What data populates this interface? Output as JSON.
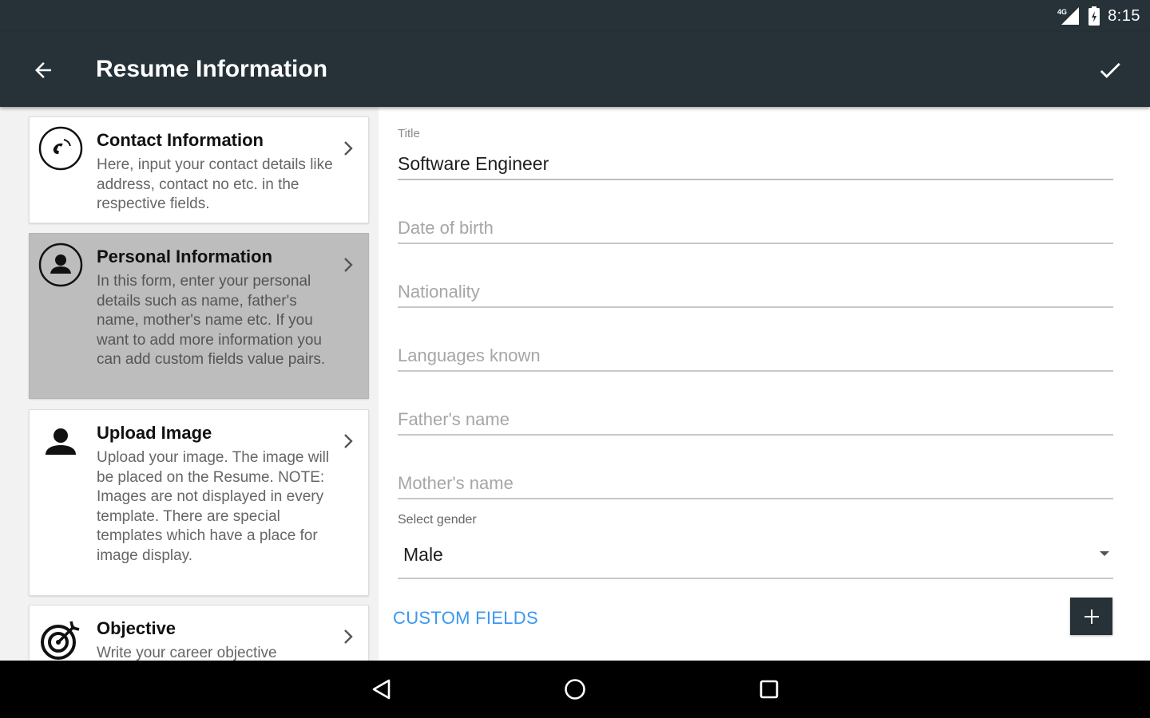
{
  "status_bar": {
    "time": "8:15",
    "network_icon": "signal-4g-icon",
    "battery_icon": "battery-icon"
  },
  "app_bar": {
    "title": "Resume Information",
    "back_icon": "arrow-back-icon",
    "confirm_icon": "check-icon"
  },
  "sections": [
    {
      "title": "Contact Information",
      "description": "Here, input your contact details like address, contact no etc. in the respective fields.",
      "icon": "phone-icon",
      "active": false
    },
    {
      "title": "Personal Information",
      "description": "In this form, enter your personal details such as name, father's name, mother's name etc. If you want to add more information you can add custom fields value pairs.",
      "icon": "person-circle-icon",
      "active": true
    },
    {
      "title": "Upload Image",
      "description": "Upload your image. The image will be placed on the Resume. NOTE: Images are not displayed in every template. There are special templates which have a place for image display.",
      "icon": "person-icon",
      "active": false
    },
    {
      "title": "Objective",
      "description": "Write your career objective",
      "icon": "target-icon",
      "active": false
    }
  ],
  "form": {
    "title_label": "Title",
    "title_value": "Software Engineer",
    "dob_placeholder": "Date of birth",
    "nationality_placeholder": "Nationality",
    "languages_placeholder": "Languages known",
    "father_placeholder": "Father's name",
    "mother_placeholder": "Mother's name",
    "gender_label": "Select gender",
    "gender_value": "Male",
    "custom_fields_label": "CUSTOM FIELDS",
    "add_icon": "plus-icon"
  },
  "nav_bar": {
    "back": "nav-back-icon",
    "home": "nav-home-icon",
    "recents": "nav-recents-icon"
  },
  "colors": {
    "toolbar": "#263238",
    "accent": "#3b97f1",
    "active_card": "#bdbdbd"
  }
}
